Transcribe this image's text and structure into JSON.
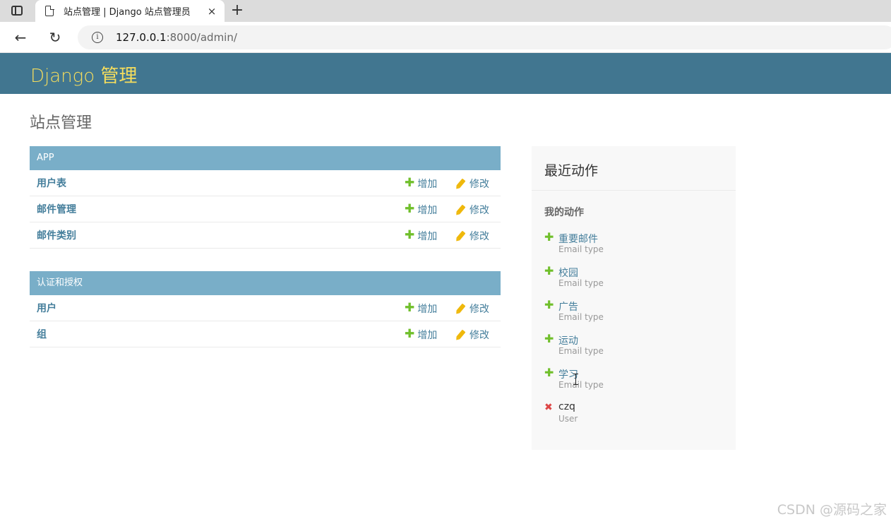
{
  "browser": {
    "tab_title": "站点管理 | Django 站点管理员",
    "tab_close": "×",
    "new_tab": "+",
    "back": "←",
    "reload": "↻",
    "url_host": "127.0.0.1",
    "url_rest": ":8000/admin/"
  },
  "header": {
    "brand": "Django 管理"
  },
  "page": {
    "title": "站点管理"
  },
  "modules": [
    {
      "caption": "APP",
      "models": [
        {
          "name": "用户表",
          "add": "增加",
          "change": "修改"
        },
        {
          "name": "邮件管理",
          "add": "增加",
          "change": "修改"
        },
        {
          "name": "邮件类别",
          "add": "增加",
          "change": "修改"
        }
      ]
    },
    {
      "caption": "认证和授权",
      "models": [
        {
          "name": "用户",
          "add": "增加",
          "change": "修改"
        },
        {
          "name": "组",
          "add": "增加",
          "change": "修改"
        }
      ]
    }
  ],
  "recent": {
    "title": "最近动作",
    "my_actions": "我的动作",
    "items": [
      {
        "icon": "add-icon",
        "name": "重要邮件",
        "type": "Email type"
      },
      {
        "icon": "add-icon",
        "name": "校园",
        "type": "Email type"
      },
      {
        "icon": "add-icon",
        "name": "广告",
        "type": "Email type"
      },
      {
        "icon": "add-icon",
        "name": "运动",
        "type": "Email type"
      },
      {
        "icon": "add-icon",
        "name": "学习",
        "type": "Email type"
      },
      {
        "icon": "delete-icon",
        "name": "czq",
        "type": "User"
      }
    ]
  },
  "icons": {
    "plus": "✚",
    "delete": "✖",
    "info": "i"
  },
  "colors": {
    "header": "#417690",
    "brand": "#f5dd5d",
    "caption": "#79aec8",
    "link": "#447e9b",
    "add": "#70bf2b",
    "change": "#efb80b",
    "delete": "#dd4646"
  },
  "watermark": "CSDN @源码之家"
}
